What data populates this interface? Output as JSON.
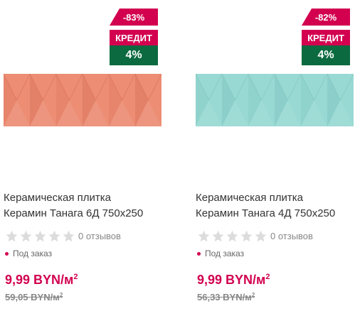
{
  "products": [
    {
      "discount": "-83%",
      "credit_label": "КРЕДИТ",
      "credit_rate": "4%",
      "tile_color": "#ec8d74",
      "tile_shade": "#d9725a",
      "name_line1": "Керамическая плитка",
      "name_line2": "Керамин Танага 6Д 750х250",
      "rating": 0,
      "reviews": "0 отзывов",
      "availability": "Под заказ",
      "price": "9,99 BYN/м",
      "price_unit_sup": "2",
      "old_price": "59,05 BYN/м",
      "old_price_sup": "2"
    },
    {
      "discount": "-82%",
      "credit_label": "КРЕДИТ",
      "credit_rate": "4%",
      "tile_color": "#98d9d3",
      "tile_shade": "#7fc4be",
      "name_line1": "Керамическая плитка",
      "name_line2": "Керамин Танага 4Д 750х250",
      "rating": 0,
      "reviews": "0 отзывов",
      "availability": "Под заказ",
      "price": "9,99 BYN/м",
      "price_unit_sup": "2",
      "old_price": "56,33 BYN/м",
      "old_price_sup": "2"
    }
  ],
  "colors": {
    "accent": "#d2004f",
    "credit_green": "#0b6a3f",
    "star_empty": "#dcdcdc"
  }
}
